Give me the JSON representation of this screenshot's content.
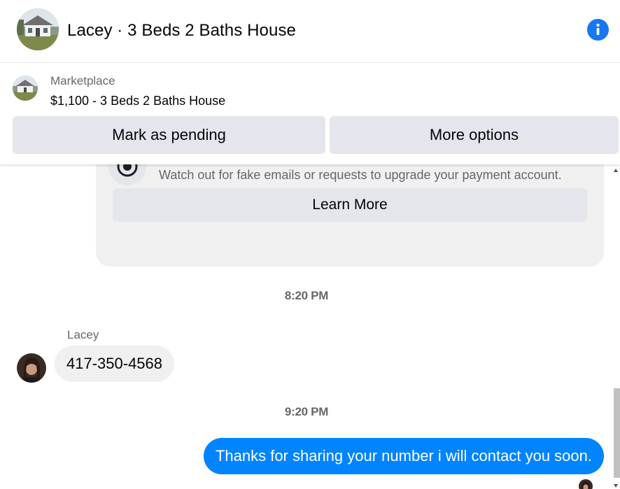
{
  "header": {
    "title": "Lacey · 3 Beds 2 Baths House",
    "avatar_icon": "house-photo-icon",
    "info_icon": "info-icon"
  },
  "listing": {
    "source": "Marketplace",
    "title": "$1,100 - 3 Beds 2 Baths House",
    "thumb_icon": "house-photo-icon",
    "mark_pending_label": "Mark as pending",
    "more_options_label": "More options"
  },
  "notice": {
    "icon": "shield-icon",
    "text": "Watch out for fake emails or requests to upgrade your payment account.",
    "learn_more_label": "Learn More"
  },
  "messages": [
    {
      "type": "timestamp",
      "text": "8:20 PM"
    },
    {
      "type": "incoming",
      "sender": "Lacey",
      "text": "417-350-4568"
    },
    {
      "type": "timestamp",
      "text": "9:20 PM"
    },
    {
      "type": "outgoing",
      "text": "Thanks for sharing your number i will contact you soon."
    }
  ],
  "colors": {
    "accent": "#1877f2",
    "outgoing_bubble": "#0084ff",
    "incoming_bubble": "#f0f0f0",
    "button_bg": "#e4e6eb",
    "secondary_text": "#65676b"
  }
}
